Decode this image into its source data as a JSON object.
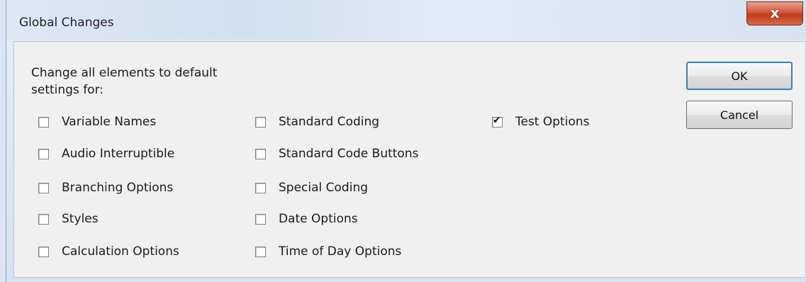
{
  "window": {
    "title": "Global Changes",
    "close_label": "x"
  },
  "instruction": "Change all elements to default\nsettings for:",
  "options": {
    "col1": [
      {
        "label": "Variable Names",
        "checked": false
      },
      {
        "label": "Audio Interruptible",
        "checked": false
      },
      {
        "label": "Branching Options",
        "checked": false
      },
      {
        "label": "Styles",
        "checked": false
      },
      {
        "label": "Calculation Options",
        "checked": false
      }
    ],
    "col2": [
      {
        "label": "Standard Coding",
        "checked": false
      },
      {
        "label": "Standard Code Buttons",
        "checked": false
      },
      {
        "label": "Special Coding",
        "checked": false
      },
      {
        "label": "Date Options",
        "checked": false
      },
      {
        "label": "Time of Day Options",
        "checked": false
      }
    ],
    "col3": [
      {
        "label": "Test Options",
        "checked": true
      }
    ]
  },
  "buttons": {
    "ok": "OK",
    "cancel": "Cancel"
  }
}
